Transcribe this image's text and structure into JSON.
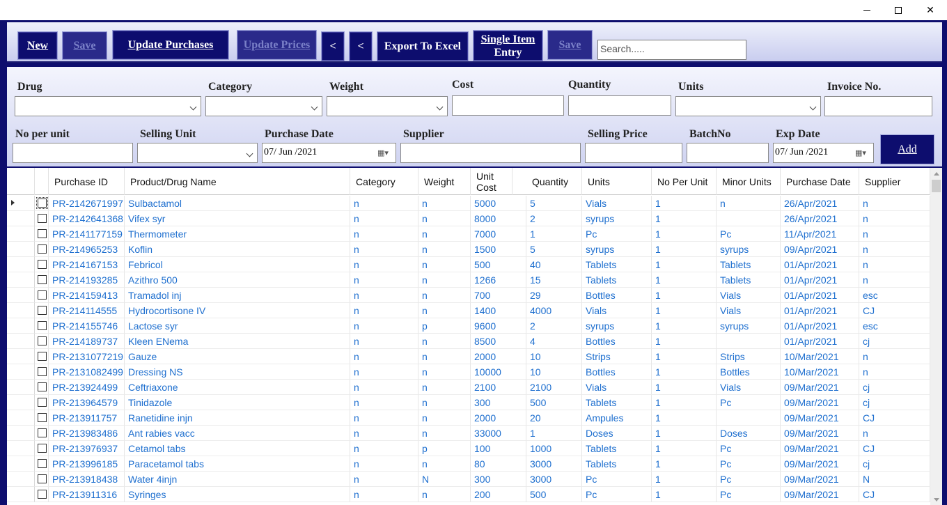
{
  "window": {
    "minimize": "—",
    "maximize": "☐",
    "close": "✕"
  },
  "toolbar": {
    "new": "New",
    "save1": "Save",
    "update_purchases": "Update Purchases",
    "update_prices": "Update Prices",
    "prev1": "<",
    "prev2": "<",
    "export": "Export To Excel",
    "single_item_line1": "Single Item",
    "single_item_line2": "Entry",
    "save2": "Save",
    "search_placeholder": "Search....."
  },
  "form": {
    "drug": "Drug",
    "category": "Category",
    "weight": "Weight",
    "cost": "Cost",
    "quantity": "Quantity",
    "units": "Units",
    "invoice": "Invoice No.",
    "no_per_unit": "No per unit",
    "selling_unit": "Selling Unit",
    "purchase_date": "Purchase Date",
    "purchase_date_value": "07/ Jun /2021",
    "supplier": "Supplier",
    "selling_price": "Selling Price",
    "batch": "BatchNo",
    "exp_date": "Exp Date",
    "exp_date_value": "07/ Jun /2021",
    "add": "Add"
  },
  "grid": {
    "headers": [
      "Purchase ID",
      "Product/Drug Name",
      "Category",
      "Weight",
      "Unit Cost",
      "Quantity",
      "Units",
      "No Per Unit",
      "Minor Units",
      "Purchase Date",
      "Supplier"
    ],
    "rows": [
      [
        "PR-2142671997",
        "Sulbactamol",
        "n",
        "n",
        "5000",
        "5",
        "Vials",
        "1",
        "n",
        "26/Apr/2021",
        "n"
      ],
      [
        "PR-2142641368",
        "Vifex syr",
        "n",
        "n",
        "8000",
        "2",
        "syrups",
        "1",
        "",
        "26/Apr/2021",
        "n"
      ],
      [
        "PR-2141177159",
        "Thermometer",
        "n",
        "n",
        "7000",
        "1",
        "Pc",
        "1",
        "Pc",
        "11/Apr/2021",
        "n"
      ],
      [
        "PR-214965253",
        "Koflin",
        "n",
        "n",
        "1500",
        "5",
        "syrups",
        "1",
        "syrups",
        "09/Apr/2021",
        "n"
      ],
      [
        "PR-214167153",
        "Febricol",
        "n",
        "n",
        "500",
        "40",
        "Tablets",
        "1",
        "Tablets",
        "01/Apr/2021",
        "n"
      ],
      [
        "PR-214193285",
        "Azithro 500",
        "n",
        "n",
        "1266",
        "15",
        "Tablets",
        "1",
        "Tablets",
        "01/Apr/2021",
        "n"
      ],
      [
        "PR-214159413",
        "Tramadol inj",
        "n",
        "n",
        "700",
        "29",
        "Bottles",
        "1",
        "Vials",
        "01/Apr/2021",
        "esc"
      ],
      [
        "PR-214114555",
        "Hydrocortisone IV",
        "n",
        "n",
        "1400",
        "4000",
        "Vials",
        "1",
        "Vials",
        "01/Apr/2021",
        "CJ"
      ],
      [
        "PR-214155746",
        "Lactose syr",
        "n",
        "p",
        "9600",
        "2",
        "syrups",
        "1",
        "syrups",
        "01/Apr/2021",
        "esc"
      ],
      [
        "PR-214189737",
        "Kleen ENema",
        "n",
        "n",
        "8500",
        "4",
        "Bottles",
        "1",
        "",
        "01/Apr/2021",
        "cj"
      ],
      [
        "PR-2131077219",
        "Gauze",
        "n",
        "n",
        "2000",
        "10",
        "Strips",
        "1",
        "Strips",
        "10/Mar/2021",
        "n"
      ],
      [
        "PR-2131082499",
        "Dressing NS",
        "n",
        "n",
        "10000",
        "10",
        "Bottles",
        "1",
        "Bottles",
        "10/Mar/2021",
        "n"
      ],
      [
        "PR-213924499",
        "Ceftriaxone",
        "n",
        "n",
        "2100",
        "2100",
        "Vials",
        "1",
        "Vials",
        "09/Mar/2021",
        "cj"
      ],
      [
        "PR-213964579",
        "Tinidazole",
        "n",
        "n",
        "300",
        "500",
        "Tablets",
        "1",
        "Pc",
        "09/Mar/2021",
        "cj"
      ],
      [
        "PR-213911757",
        "Ranetidine injn",
        "n",
        "n",
        "2000",
        "20",
        "Ampules",
        "1",
        "",
        "09/Mar/2021",
        "CJ"
      ],
      [
        "PR-213983486",
        "Ant rabies vacc",
        "n",
        "n",
        "33000",
        "1",
        "Doses",
        "1",
        "Doses",
        "09/Mar/2021",
        "n"
      ],
      [
        "PR-213976937",
        "Cetamol tabs",
        "n",
        "p",
        "100",
        "1000",
        "Tablets",
        "1",
        "Pc",
        "09/Mar/2021",
        "CJ"
      ],
      [
        "PR-213996185",
        "Paracetamol tabs",
        "n",
        "n",
        "80",
        "3000",
        "Tablets",
        "1",
        "Pc",
        "09/Mar/2021",
        "cj"
      ],
      [
        "PR-213918438",
        "Water 4injn",
        "n",
        "N",
        "300",
        "3000",
        "Pc",
        "1",
        "Pc",
        "09/Mar/2021",
        "N"
      ],
      [
        "PR-213911316",
        "Syringes",
        "n",
        "n",
        "200",
        "500",
        "Pc",
        "1",
        "Pc",
        "09/Mar/2021",
        "CJ"
      ]
    ]
  }
}
